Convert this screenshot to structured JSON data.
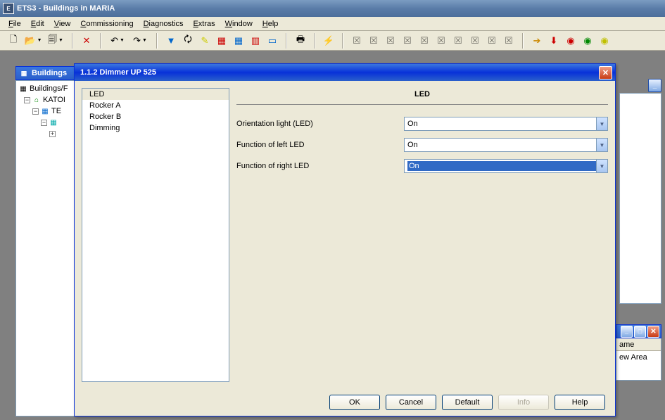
{
  "app": {
    "title": "ETS3 - Buildings in MARIA"
  },
  "menubar": {
    "items": [
      "File",
      "Edit",
      "View",
      "Commissioning",
      "Diagnostics",
      "Extras",
      "Window",
      "Help"
    ]
  },
  "toolbar": {
    "groups": [
      [
        "new-icon",
        "open-icon",
        "copy-icon"
      ],
      [
        "delete-icon"
      ],
      [
        "undo-icon",
        "redo-icon"
      ],
      [
        "filter-icon",
        "refresh-icon",
        "highlight-icon",
        "table-icon",
        "grid-icon",
        "columns-icon",
        "panel-icon"
      ],
      [
        "print-icon"
      ],
      [
        "run-icon"
      ],
      [
        "d1",
        "d2",
        "d3",
        "d4",
        "d5",
        "d6",
        "d7",
        "d8",
        "d9",
        "d10"
      ],
      [
        "arrow-icon",
        "down-icon",
        "stop-icon",
        "green-icon",
        "led-icon"
      ]
    ]
  },
  "tree": {
    "title": "Buildings",
    "root": "Buildings/F",
    "n1": "KATOI",
    "n2": "TE",
    "n3": ""
  },
  "bottom_right": {
    "header": "ame",
    "row": "ew Area"
  },
  "dialog": {
    "title": "1.1.2 Dimmer UP 525",
    "sidebar": {
      "items": [
        "LED",
        "Rocker A",
        "Rocker B",
        "Dimming"
      ],
      "selected": 0
    },
    "main": {
      "heading": "LED",
      "rows": [
        {
          "label": "Orientation light (LED)",
          "value": "On",
          "focused": false
        },
        {
          "label": "Function of left LED",
          "value": "On",
          "focused": false
        },
        {
          "label": "Function of right LED",
          "value": "On",
          "focused": true
        }
      ]
    },
    "buttons": {
      "ok": "OK",
      "cancel": "Cancel",
      "default": "Default",
      "info": "Info",
      "help": "Help"
    }
  }
}
